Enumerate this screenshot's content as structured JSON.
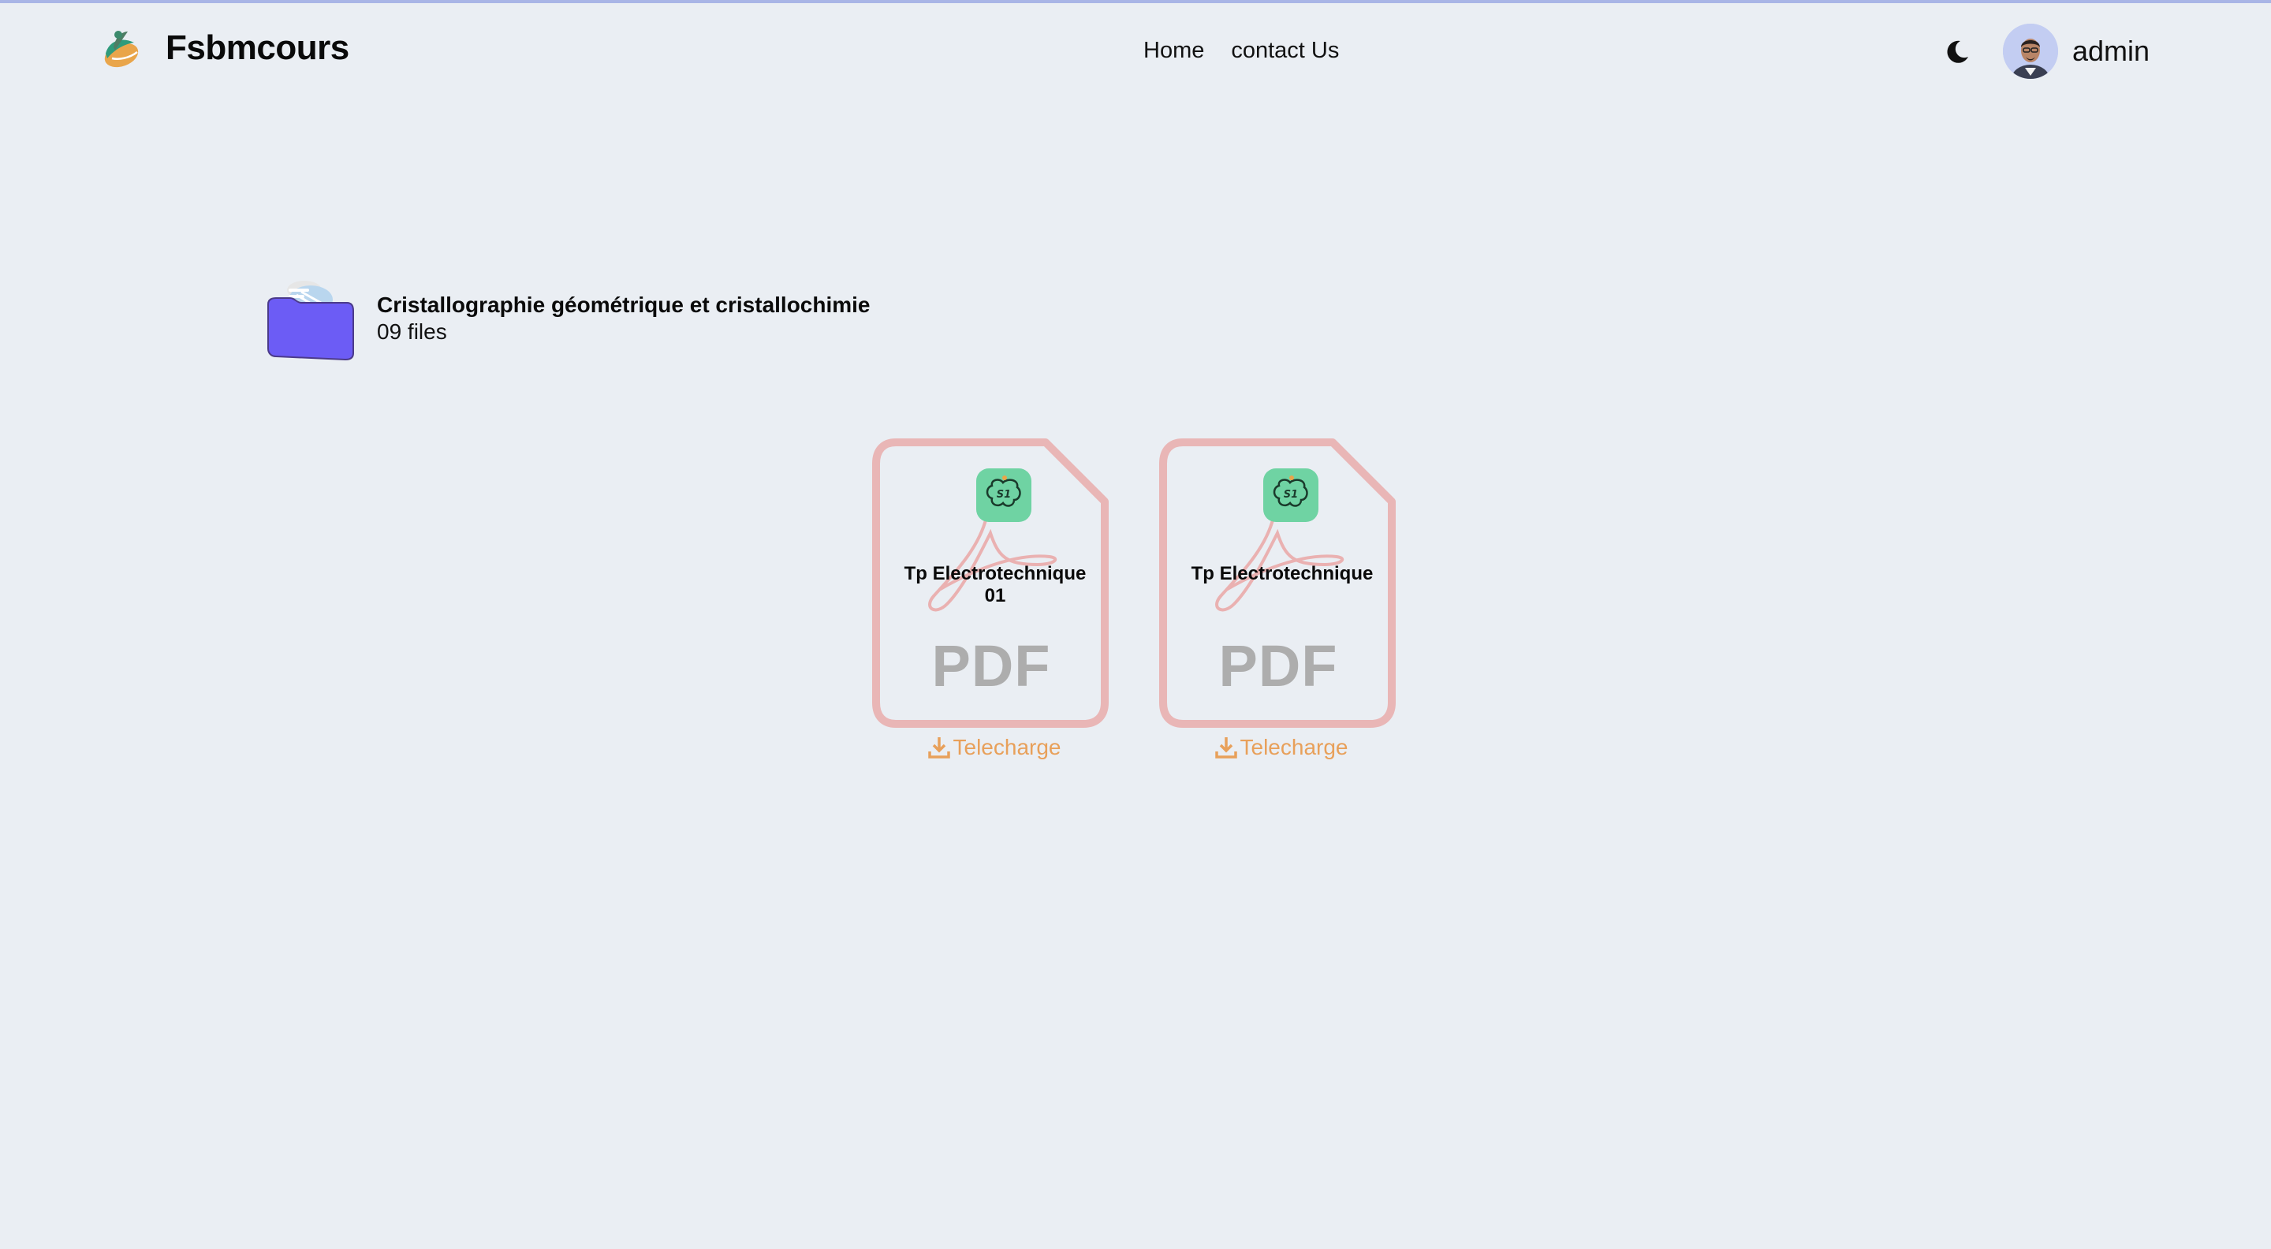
{
  "brand": {
    "name": "Fsbmcours",
    "logo_icon": "leaf-logo-icon"
  },
  "nav": {
    "items": [
      "Home",
      "contact Us"
    ]
  },
  "header": {
    "theme_icon": "moon-icon",
    "user_name": "admin"
  },
  "folder": {
    "title": "Cristallographie géométrique et cristallochimie",
    "file_count": "09 files",
    "icon": "folder-icon",
    "accent_color": "#6c5cf5"
  },
  "files": [
    {
      "title": "Tp Electrotechnique 01",
      "type": "PDF",
      "download_label": "Telecharge"
    },
    {
      "title": "Tp Electrotechnique",
      "type": "PDF",
      "download_label": "Telecharge"
    }
  ],
  "colors": {
    "background": "#eaeef3",
    "pdf_outline": "#e9b6b6",
    "badge": "#6fd3a3",
    "download": "#e8a05a"
  }
}
